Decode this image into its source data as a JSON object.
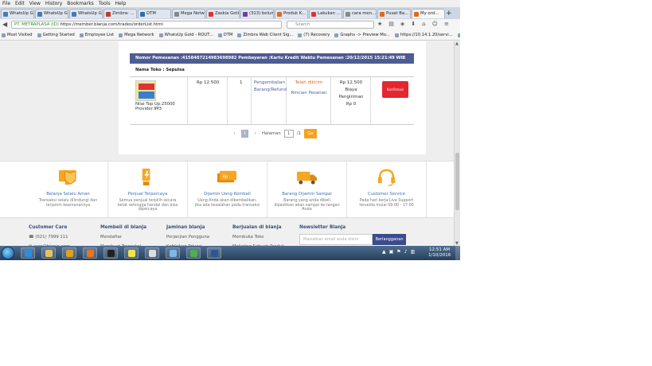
{
  "menu": [
    "File",
    "Edit",
    "View",
    "History",
    "Bookmarks",
    "Tools",
    "Help"
  ],
  "tabs": [
    {
      "label": "WhatsUp Gold -",
      "color": "#4a7ab5"
    },
    {
      "label": "WhatsUp Gold -",
      "color": "#4a7ab5"
    },
    {
      "label": "WhatsUp Gold -",
      "color": "#4a7ab5"
    },
    {
      "label": "Zimbra: ...",
      "color": "#c0392b"
    },
    {
      "label": "DTM",
      "color": "#2a6fb0"
    },
    {
      "label": "Mega Network",
      "color": "#888888"
    },
    {
      "label": "Zaskia Gotik...",
      "color": "#d33"
    },
    {
      "label": "(313) belum ...",
      "color": "#7a3aa0"
    },
    {
      "label": "Produk K...",
      "color": "#e06b1a"
    },
    {
      "label": "Lakukan ...",
      "color": "#d33"
    },
    {
      "label": "cara men...",
      "color": "#888888"
    },
    {
      "label": "Pusat Ba...",
      "color": "#e06b1a"
    },
    {
      "label": "My ord...",
      "color": "#e06b1a"
    }
  ],
  "nav": {
    "site_label": "PT. METRAPLASA (ID)",
    "url": "https://member.blanja.com/trades/orderList.html",
    "search_placeholder": "Search"
  },
  "bookmarks": [
    "Most Visited",
    "Getting Started",
    "Employee List",
    "Mega Network",
    "WhatsUp Gold - ROUT...",
    "DTM",
    "Zimbra Web Client Sig...",
    "(7) Recovery",
    "Graphs -> Preview Mo...",
    "https://10.14.1.20/servi...",
    "MRTG XL"
  ],
  "order": {
    "header": "Nomor Pemesanan :4158487214983698982       Pembayaran :Kartu Kredit     Waktu Pemesanan :20/12/2015 15:21:49 WIB",
    "toko": "Nama Toko  : Sepulsa",
    "product_line1": "Nilai Top Up:25000",
    "product_line2": "Provider:IM3",
    "price": "Rp 12.500",
    "qty": "1",
    "refund_line1": "Pengembalian",
    "refund_line2": "Barang/Refund",
    "status": "Telah dikirim",
    "status_link": "Rincian Pesanan",
    "total_line1": "Rp 12.500",
    "total_line2": "Biaya",
    "total_line3": "Pengiriman",
    "total_line4": "Rp 0",
    "confirm_label": "Konfirmasi"
  },
  "pager": {
    "prev": "‹",
    "current": "1",
    "next": "›",
    "halaman_label": "Halaman",
    "input_value": "1",
    "total": "/1",
    "go_label": "Go"
  },
  "features": [
    {
      "title": "Belanja Selalu Aman",
      "desc": "Transaksi selalu dilindungi dan terjamin keamanannya",
      "icon": "secure-shopping-icon"
    },
    {
      "title": "Penjual Terpercaya",
      "desc": "Semua penjual terpilih secara ketat sehingga handal dan bisa dipercaya",
      "icon": "trusted-seller-icon"
    },
    {
      "title": "Dijamin Uang Kembali",
      "desc": "Uang Anda akan dikembalikan, jika ada kesalahan pada transaksi",
      "icon": "money-back-icon"
    },
    {
      "title": "Barang Dijamin Sampai",
      "desc": "Barang yang anda dibeli dipastikan akan sampai ke tangan Anda",
      "icon": "delivery-truck-icon"
    },
    {
      "title": "Customer Service",
      "desc": "Pada hari kerja Live Support tersedia mulai 09:00 - 17:00",
      "icon": "headset-icon"
    }
  ],
  "footer": {
    "care_title": "Customer Care",
    "phone": "(021) 7999 111",
    "email": "care@blanja.com",
    "buy_title": "Membeli di blanja",
    "buy_1": "Mendaftar",
    "buy_2": "Membuat Transaksi",
    "guarantee_title": "Jaminan blanja",
    "guarantee_1": "Perjanjian Pengguna",
    "guarantee_2": "Kebijakan Privasi",
    "sell_title": "Berjualan di blanja",
    "sell_1": "Membuka Toko",
    "sell_2": "Melisting Sebuah Produk",
    "news_title": "Newsletter Blanja",
    "news_placeholder": "Masukkan email anda disini",
    "news_button": "Berlangganan"
  },
  "taskbar": {
    "apps": [
      {
        "icon": "ie-icon",
        "color": "#2a8fe0"
      },
      {
        "icon": "explorer-icon",
        "color": "#e8c35a"
      },
      {
        "icon": "media-player-icon",
        "color": "#e0a020"
      },
      {
        "icon": "firefox-icon",
        "color": "#e8761a"
      },
      {
        "icon": "console-icon",
        "color": "#222222"
      },
      {
        "icon": "sticky-notes-icon",
        "color": "#f2e34a"
      },
      {
        "icon": "snipping-tool-icon",
        "color": "#dddddd"
      },
      {
        "icon": "paint-icon",
        "color": "#7fb7e8"
      },
      {
        "icon": "network-icon",
        "color": "#4caf50"
      },
      {
        "icon": "word-icon",
        "color": "#2b5797"
      }
    ],
    "time": "12:51 AM",
    "date": "1/10/2016"
  }
}
